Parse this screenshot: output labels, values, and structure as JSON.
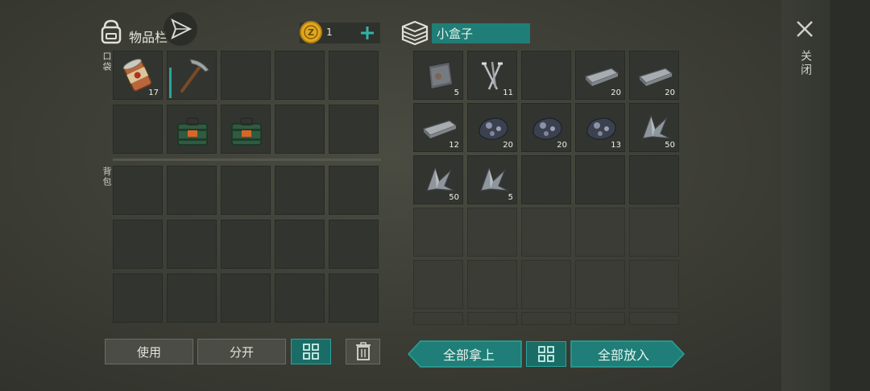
{
  "inventory": {
    "title": "物品栏",
    "pocket_label": "口袋",
    "backpack_label": "背包",
    "coins": {
      "count": "1"
    },
    "pocket_slots": [
      {
        "item": "tin-can",
        "qty": "17"
      },
      {
        "item": "pickaxe",
        "qty": ""
      },
      {
        "item": "",
        "qty": ""
      },
      {
        "item": "",
        "qty": ""
      },
      {
        "item": "",
        "qty": ""
      },
      {
        "item": "",
        "qty": ""
      },
      {
        "item": "green-crate",
        "qty": ""
      },
      {
        "item": "green-crate",
        "qty": ""
      },
      {
        "item": "",
        "qty": ""
      },
      {
        "item": "",
        "qty": ""
      }
    ],
    "buttons": {
      "use": "使用",
      "split": "分开"
    }
  },
  "container": {
    "name": "小盒子",
    "slots": [
      {
        "item": "metal-plate",
        "qty": "5"
      },
      {
        "item": "nails",
        "qty": "11"
      },
      {
        "item": "",
        "qty": ""
      },
      {
        "item": "iron-ingot",
        "qty": "20"
      },
      {
        "item": "iron-ingot",
        "qty": "20"
      },
      {
        "item": "iron-ingot",
        "qty": "12"
      },
      {
        "item": "iron-ore",
        "qty": "20"
      },
      {
        "item": "iron-ore",
        "qty": "20"
      },
      {
        "item": "iron-ore",
        "qty": "13"
      },
      {
        "item": "scrap-metal",
        "qty": "50"
      },
      {
        "item": "scrap-metal",
        "qty": "50"
      },
      {
        "item": "scrap-metal",
        "qty": "5"
      }
    ],
    "buttons": {
      "take_all": "全部拿上",
      "put_all": "全部放入"
    }
  },
  "close": {
    "label": "关闭"
  },
  "colors": {
    "accent": "#1f7e77",
    "coin": "#e0a81e"
  }
}
